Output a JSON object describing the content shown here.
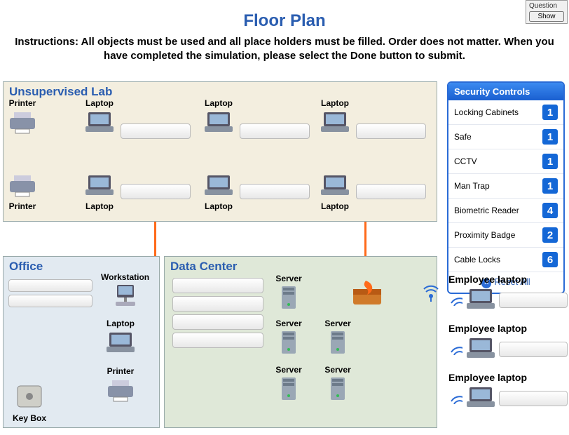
{
  "topright": {
    "label": "Question",
    "button": "Show"
  },
  "title": "Floor Plan",
  "instructions": "Instructions: All objects must be used and all place holders must be filled. Order does not matter. When you have completed the simulation, please select the Done button to submit.",
  "zones": {
    "unsupervised": "Unsupervised Lab",
    "office": "Office",
    "datacenter": "Data Center"
  },
  "labels": {
    "printer": "Printer",
    "laptop": "Laptop",
    "workstation": "Workstation",
    "server": "Server",
    "keybox": "Key Box",
    "employee_laptop": "Employee laptop"
  },
  "panel": {
    "title": "Security Controls",
    "controls": [
      {
        "name": "Locking Cabinets",
        "count": 1
      },
      {
        "name": "Safe",
        "count": 1
      },
      {
        "name": "CCTV",
        "count": 1
      },
      {
        "name": "Man Trap",
        "count": 1
      },
      {
        "name": "Biometric Reader",
        "count": 4
      },
      {
        "name": "Proximity Badge",
        "count": 2
      },
      {
        "name": "Cable Locks",
        "count": 6
      }
    ],
    "reset": "Reset  All"
  }
}
